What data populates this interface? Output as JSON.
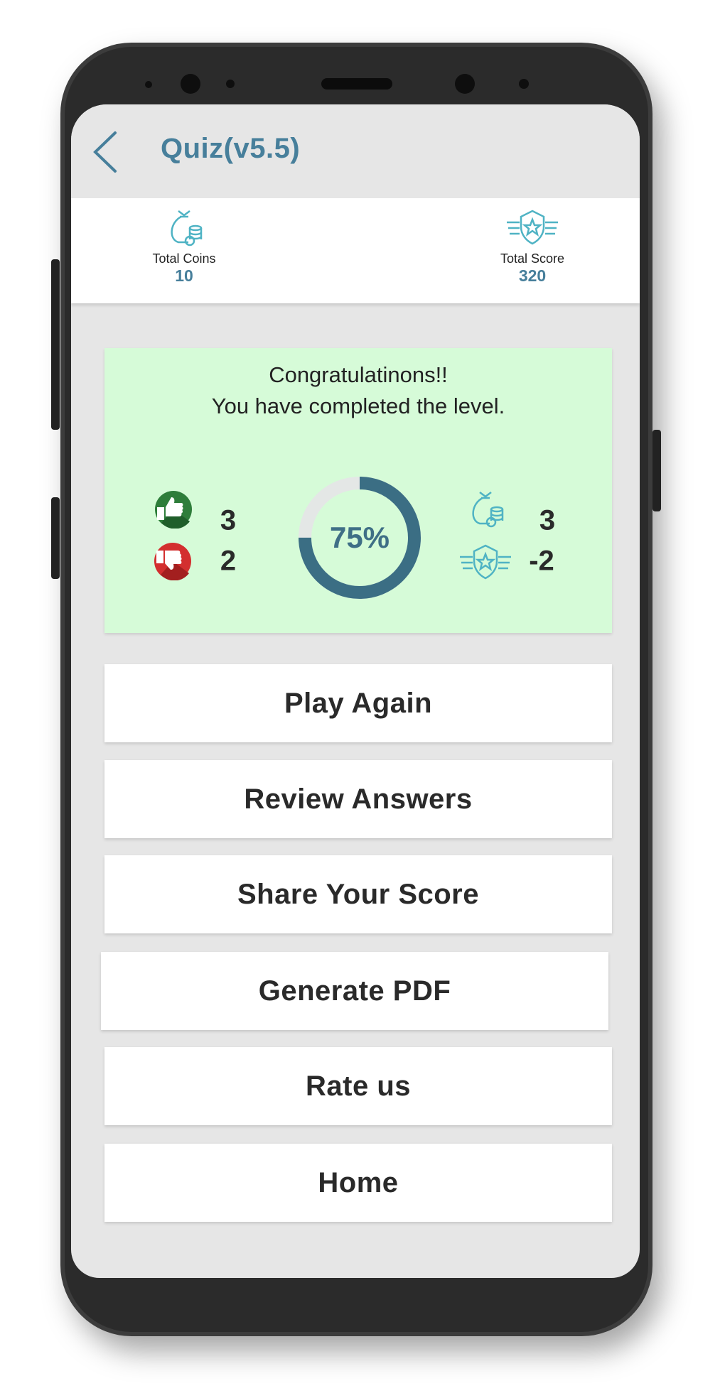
{
  "header": {
    "title": "Quiz(v5.5)"
  },
  "stats": {
    "coins": {
      "label": "Total Coins",
      "value": "10",
      "icon": "money-bag-icon"
    },
    "score": {
      "label": "Total Score",
      "value": "320",
      "icon": "shield-star-icon"
    }
  },
  "result": {
    "line1": "Congratulatinons!!",
    "line2": "You have completed the level.",
    "correct": "3",
    "wrong": "2",
    "percent_label": "75%",
    "percent": 75,
    "coins_earned": "3",
    "score_change": "-2"
  },
  "buttons": [
    "Play Again",
    "Review Answers",
    "Share Your Score",
    "Generate PDF",
    "Rate us",
    "Home"
  ],
  "colors": {
    "accent": "#477f9b",
    "donut": "#3b6e84",
    "card": "#d6fbd8",
    "correct": "#2e7d3a",
    "wrong": "#d32f2f",
    "icon": "#4fb3c4"
  }
}
